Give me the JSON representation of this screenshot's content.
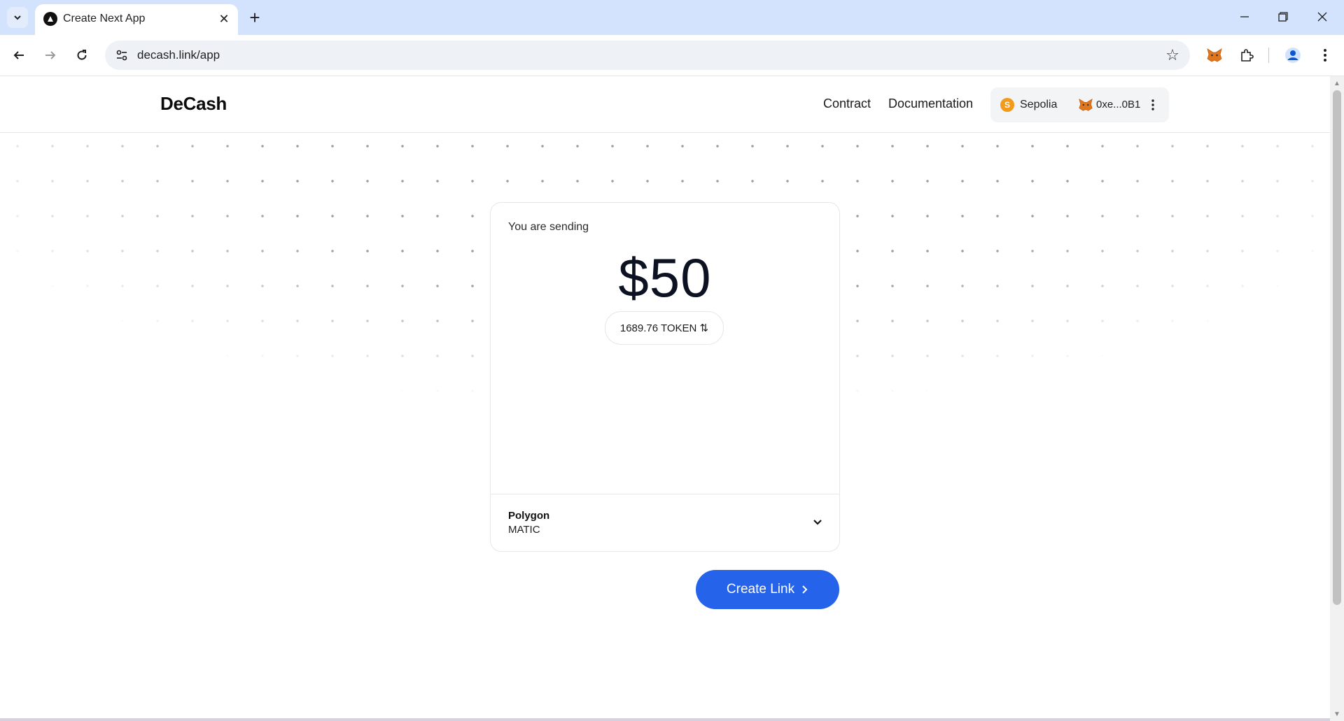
{
  "browser": {
    "tab_title": "Create Next App",
    "url": "decash.link/app",
    "new_tab_symbol": "+",
    "close_symbol": "✕"
  },
  "site": {
    "logo": "DeCash",
    "nav": {
      "contract": "Contract",
      "documentation": "Documentation"
    },
    "wallet": {
      "network_initial": "S",
      "network": "Sepolia",
      "address": "0xe...0B1"
    }
  },
  "send_card": {
    "label": "You are sending",
    "amount": "$50",
    "token_amount": "1689.76 TOKEN ⇅",
    "chain": {
      "name": "Polygon",
      "token": "MATIC"
    }
  },
  "actions": {
    "create_link": "Create Link"
  },
  "colors": {
    "primary": "#2563eb",
    "network_dot": "#f29a1a",
    "tabbar": "#d3e3fd"
  }
}
